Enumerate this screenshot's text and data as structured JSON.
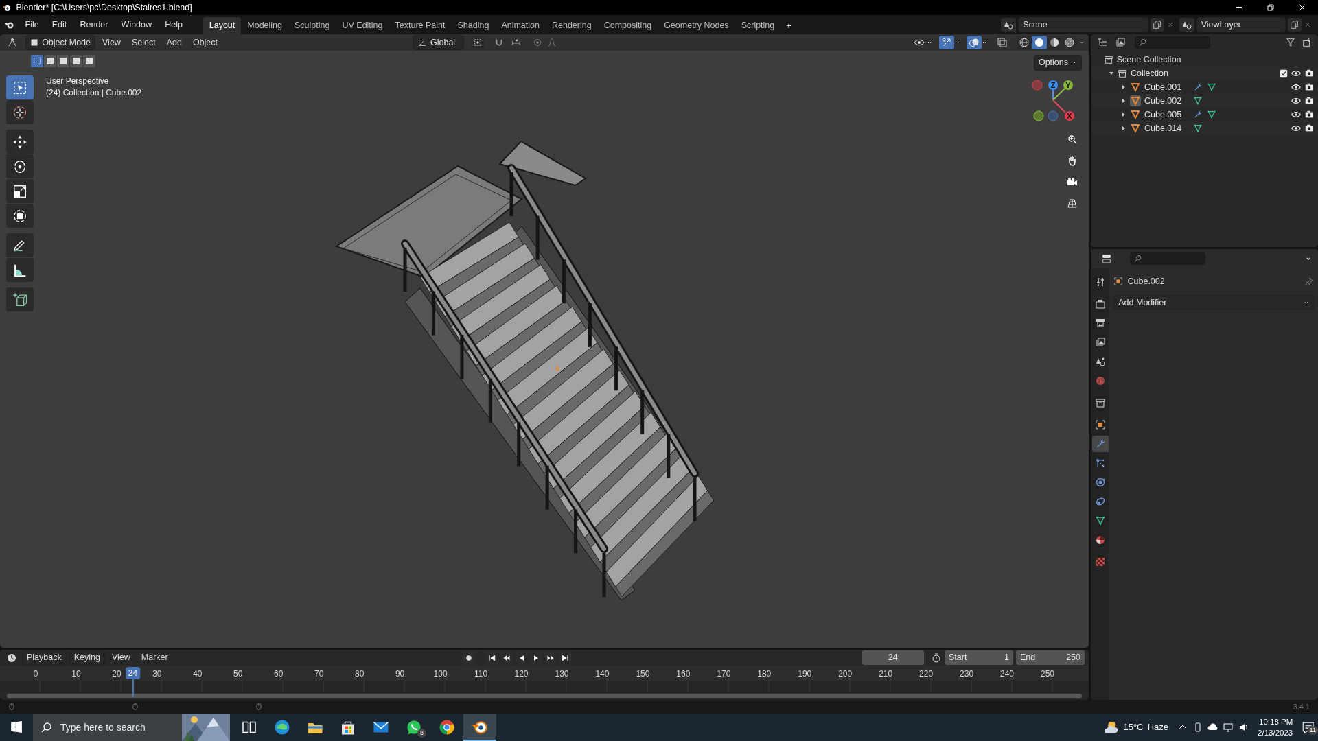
{
  "window": {
    "title": "Blender* [C:\\Users\\pc\\Desktop\\Staires1.blend]"
  },
  "menus": [
    "File",
    "Edit",
    "Render",
    "Window",
    "Help"
  ],
  "workspaces": [
    {
      "label": "Layout",
      "selected": true
    },
    {
      "label": "Modeling",
      "selected": false
    },
    {
      "label": "Sculpting",
      "selected": false
    },
    {
      "label": "UV Editing",
      "selected": false
    },
    {
      "label": "Texture Paint",
      "selected": false
    },
    {
      "label": "Shading",
      "selected": false
    },
    {
      "label": "Animation",
      "selected": false
    },
    {
      "label": "Rendering",
      "selected": false
    },
    {
      "label": "Compositing",
      "selected": false
    },
    {
      "label": "Geometry Nodes",
      "selected": false
    },
    {
      "label": "Scripting",
      "selected": false
    }
  ],
  "add_workspace": "+",
  "scene": "Scene",
  "view_layer": "ViewLayer",
  "viewport": {
    "mode": "Object Mode",
    "menus": [
      "View",
      "Select",
      "Add",
      "Object"
    ],
    "orientation": "Global",
    "options": "Options",
    "select_modes": [
      {
        "selected": true
      },
      {
        "selected": false
      },
      {
        "selected": false
      },
      {
        "selected": false
      },
      {
        "selected": false
      }
    ],
    "toggles": [
      {
        "kind": "visibility",
        "on": false
      },
      {
        "kind": "gizmo",
        "on": true
      },
      {
        "kind": "overlay",
        "on": true
      },
      {
        "kind": "xray",
        "on": false
      }
    ],
    "shading": [
      {
        "kind": "wireframe",
        "selected": false
      },
      {
        "kind": "solid",
        "selected": true
      },
      {
        "kind": "material",
        "selected": false
      },
      {
        "kind": "rendered",
        "selected": false
      }
    ],
    "overlay_lines": [
      "User Perspective",
      "(24) Collection | Cube.002"
    ],
    "tool_groups": [
      [
        {
          "kind": "select",
          "selected": true
        },
        {
          "kind": "cursor",
          "selected": false
        }
      ],
      [
        {
          "kind": "move",
          "selected": false
        },
        {
          "kind": "rotate",
          "selected": false
        },
        {
          "kind": "scale",
          "selected": false
        },
        {
          "kind": "transform",
          "selected": false
        }
      ],
      [
        {
          "kind": "annotate",
          "selected": false
        },
        {
          "kind": "measure",
          "selected": false
        }
      ],
      [
        {
          "kind": "add-cube",
          "selected": false
        }
      ]
    ],
    "axes": [
      "Z",
      "Y",
      "X"
    ]
  },
  "outliner": {
    "root": "Scene Collection",
    "collections": [
      {
        "label": "Collection",
        "expanded": true,
        "checked": true,
        "children": [
          {
            "label": "Cube.001",
            "selected": false,
            "modifiers": true
          },
          {
            "label": "Cube.002",
            "selected": true,
            "modifiers": false
          },
          {
            "label": "Cube.005",
            "selected": false,
            "modifiers": true
          },
          {
            "label": "Cube.014",
            "selected": false,
            "modifiers": false
          }
        ]
      }
    ]
  },
  "properties": {
    "object": "Cube.002",
    "add_modifier": "Add Modifier",
    "tab_groups": [
      [
        {
          "kind": "tool",
          "selected": false
        }
      ],
      [
        {
          "kind": "render",
          "selected": false
        },
        {
          "kind": "output",
          "selected": false
        },
        {
          "kind": "view-layer",
          "selected": false
        },
        {
          "kind": "scene",
          "selected": false
        },
        {
          "kind": "world",
          "selected": false
        }
      ],
      [
        {
          "kind": "collection",
          "selected": false
        }
      ],
      [
        {
          "kind": "object",
          "selected": false
        },
        {
          "kind": "modifier",
          "selected": true
        },
        {
          "kind": "particles",
          "selected": false
        },
        {
          "kind": "physics",
          "selected": false
        },
        {
          "kind": "constraints",
          "selected": false
        },
        {
          "kind": "data",
          "selected": false
        },
        {
          "kind": "material",
          "selected": false
        }
      ],
      [
        {
          "kind": "texture",
          "selected": false
        }
      ]
    ]
  },
  "timeline": {
    "menus": [
      "Playback",
      "Keying",
      "View",
      "Marker"
    ],
    "current_frame": "24",
    "start_label": "Start",
    "start": "1",
    "end_label": "End",
    "end": "250",
    "ticks": [
      "0",
      "10",
      "20",
      "30",
      "40",
      "50",
      "60",
      "70",
      "80",
      "90",
      "100",
      "110",
      "120",
      "130",
      "140",
      "150",
      "160",
      "170",
      "180",
      "190",
      "200",
      "210",
      "220",
      "230",
      "240",
      "250"
    ],
    "playhead": "24"
  },
  "status_bar": {
    "version": "3.4.1"
  },
  "taskbar": {
    "search_placeholder": "Type here to search",
    "apps": [
      {
        "kind": "task-view",
        "selected": false
      },
      {
        "kind": "edge",
        "selected": false
      },
      {
        "kind": "explorer",
        "selected": false
      },
      {
        "kind": "store",
        "selected": false
      },
      {
        "kind": "mail",
        "selected": false
      },
      {
        "kind": "whatsapp",
        "selected": false,
        "badge": "8"
      },
      {
        "kind": "chrome",
        "selected": false
      },
      {
        "kind": "blender",
        "selected": true
      }
    ],
    "weather": {
      "temperature": "15°C",
      "condition": "Haze"
    },
    "time": "10:18 PM",
    "date": "2/13/2023",
    "notifications": "11"
  }
}
